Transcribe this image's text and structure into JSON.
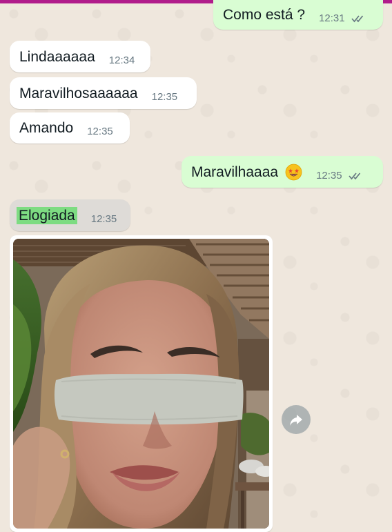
{
  "chat": {
    "messages": [
      {
        "direction": "out",
        "text": "Como está ?",
        "time": "12:31",
        "status": "read"
      },
      {
        "direction": "in",
        "text": "Lindaaaaaa",
        "time": "12:34"
      },
      {
        "direction": "in",
        "text": "Maravilhosaaaaaa",
        "time": "12:35"
      },
      {
        "direction": "in",
        "text": "Amando",
        "time": "12:35"
      },
      {
        "direction": "out",
        "text": "Maravilhaaaa",
        "emoji": "star-struck-emoji",
        "time": "12:35",
        "status": "read"
      },
      {
        "direction": "in",
        "text": "Elogiada",
        "time": "12:35",
        "highlighted": true
      }
    ],
    "photo": {
      "description_icon": "photo-message",
      "censored": true
    },
    "forward_icon": "forward-icon"
  },
  "colors": {
    "background": "#efe7dd",
    "incoming_bubble": "#ffffff",
    "outgoing_bubble": "#d9fdd3",
    "highlight": "#7ddc82",
    "read_tick": "#667781",
    "top_strip": "#b11c8b"
  }
}
